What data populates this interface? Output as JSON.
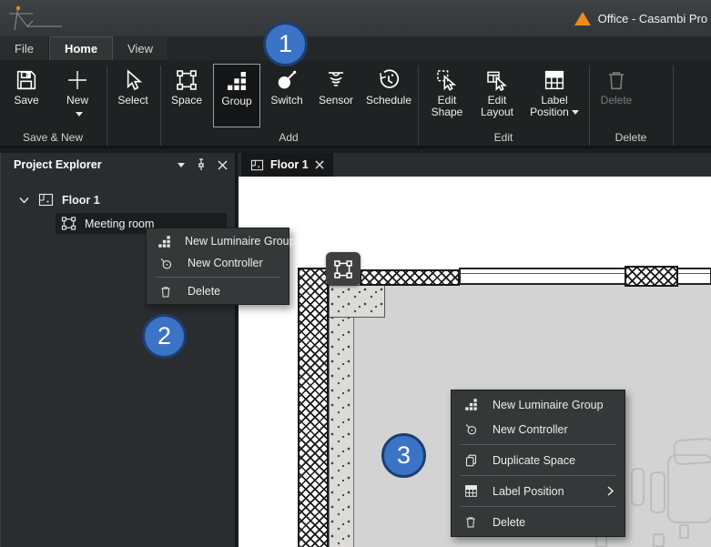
{
  "title_bar": {
    "app_title": "Office - Casambi Pro ("
  },
  "menu_tabs": [
    {
      "label": "File"
    },
    {
      "label": "Home",
      "active": true
    },
    {
      "label": "View"
    }
  ],
  "ribbon": {
    "groups": [
      {
        "label": "Save & New",
        "buttons": [
          {
            "label": "Save",
            "icon": "save-icon"
          },
          {
            "label": "New",
            "icon": "new-plus-icon",
            "has_dropdown": true
          }
        ]
      },
      {
        "label": "",
        "buttons": [
          {
            "label": "Select",
            "icon": "select-cursor-icon"
          }
        ]
      },
      {
        "label": "Add",
        "buttons": [
          {
            "label": "Space",
            "icon": "space-icon"
          },
          {
            "label": "Group",
            "icon": "group-icon",
            "selected": true
          },
          {
            "label": "Switch",
            "icon": "switch-icon"
          },
          {
            "label": "Sensor",
            "icon": "sensor-icon"
          },
          {
            "label": "Schedule",
            "icon": "schedule-icon"
          }
        ]
      },
      {
        "label": "Edit",
        "buttons": [
          {
            "label": "Edit Shape",
            "icon": "edit-shape-icon"
          },
          {
            "label": "Edit Layout",
            "icon": "edit-layout-icon"
          },
          {
            "label": "Label Position",
            "icon": "label-position-icon",
            "has_dropdown": true
          }
        ]
      },
      {
        "label": "Delete",
        "buttons": [
          {
            "label": "Delete",
            "icon": "trash-icon",
            "disabled": true
          }
        ]
      }
    ]
  },
  "project_explorer": {
    "title": "Project Explorer",
    "tree": {
      "root": {
        "label": "Floor 1",
        "icon": "floor-icon",
        "expanded": true
      },
      "child": {
        "label": "Meeting room",
        "icon": "space-icon",
        "selected": true
      }
    }
  },
  "document_tabs": [
    {
      "label": "Floor 1",
      "icon": "floor-icon",
      "active": true
    }
  ],
  "context_menus": {
    "explorer": {
      "items": [
        {
          "label": "New Luminaire Group",
          "icon": "luminaire-group-icon"
        },
        {
          "label": "New Controller",
          "icon": "controller-icon"
        },
        {
          "label": "Delete",
          "icon": "trash-icon"
        }
      ]
    },
    "canvas": {
      "items": [
        {
          "label": "New Luminaire Group",
          "icon": "luminaire-group-icon"
        },
        {
          "label": "New Controller",
          "icon": "controller-icon"
        },
        {
          "label": "Duplicate Space",
          "icon": "duplicate-icon"
        },
        {
          "label": "Label Position",
          "icon": "label-position-icon",
          "has_submenu": true
        },
        {
          "label": "Delete",
          "icon": "trash-icon"
        }
      ]
    }
  },
  "callouts": [
    {
      "number": "1"
    },
    {
      "number": "2"
    },
    {
      "number": "3"
    }
  ],
  "colors": {
    "callout_fill": "#3b73c7",
    "callout_border": "#1d3e6f",
    "logo_orange": "#ec8b1e",
    "floor_fill": "#d3d3d3",
    "menu_bg": "#353839",
    "selection_bg": "#141617"
  }
}
